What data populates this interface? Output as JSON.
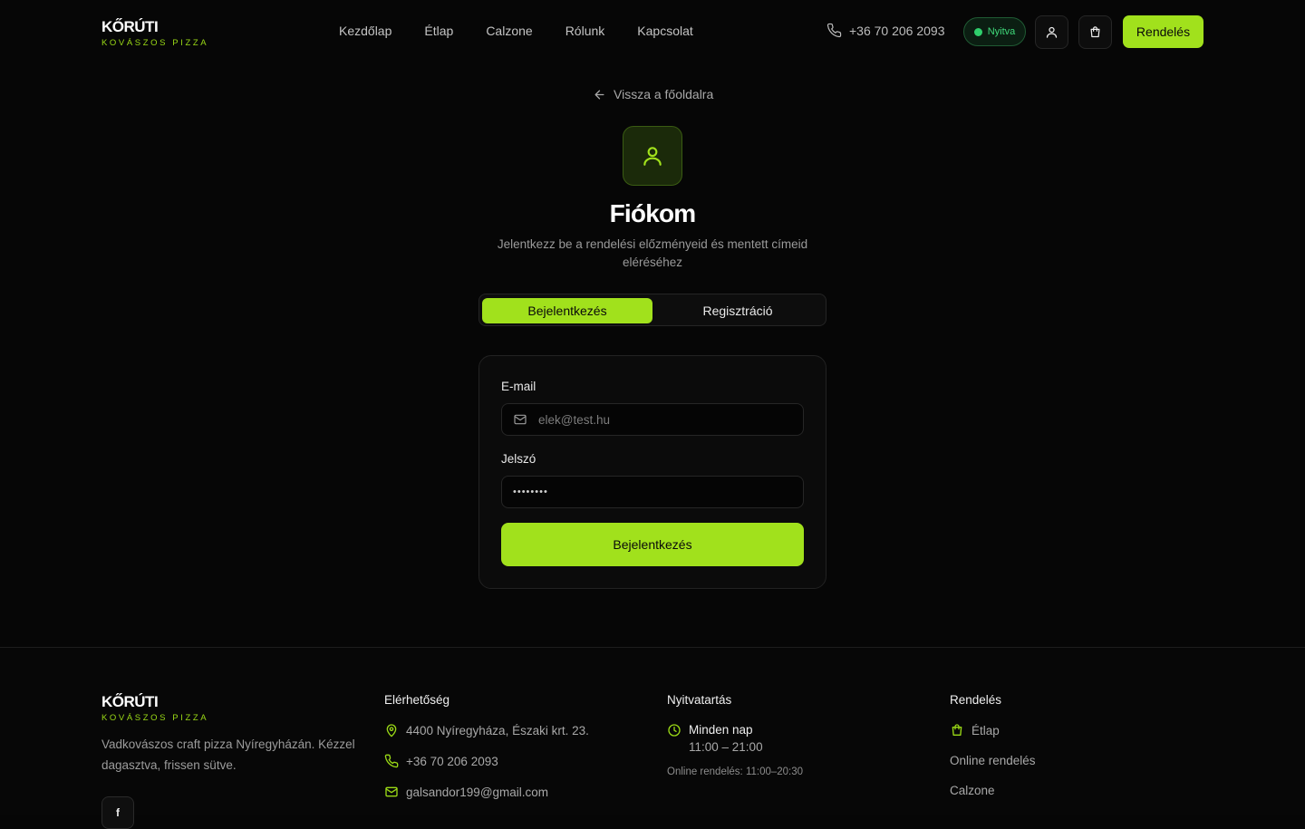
{
  "header": {
    "logo_title": "KŐRÚTI",
    "logo_sub": "KOVÁSZOS PIZZA",
    "nav": [
      "Kezdőlap",
      "Étlap",
      "Calzone",
      "Rólunk",
      "Kapcsolat"
    ],
    "phone": "+36 70 206 2093",
    "status": "Nyitva",
    "order_label": "Rendelés"
  },
  "main": {
    "back_label": "Vissza a főoldalra",
    "title": "Fiókom",
    "subtitle": "Jelentkezz be a rendelési előzményeid és mentett címeid eléréséhez",
    "tabs": [
      "Bejelentkezés",
      "Regisztráció"
    ],
    "email_label": "E-mail",
    "email_placeholder": "elek@test.hu",
    "password_label": "Jelszó",
    "password_placeholder": "••••••••",
    "submit_label": "Bejelentkezés"
  },
  "footer": {
    "logo_title": "KŐRÚTI",
    "logo_sub": "KOVÁSZOS PIZZA",
    "description": "Vadkovászos craft pizza Nyíregyházán. Kézzel dagasztva, frissen sütve.",
    "contact_heading": "Elérhetőség",
    "address": "4400 Nyíregyháza, Északi krt. 23.",
    "phone": "+36 70 206 2093",
    "email": "galsandor199@gmail.com",
    "hours_heading": "Nyitvatartás",
    "hours_days": "Minden nap",
    "hours_time": "11:00 – 21:00",
    "online_hours": "Online rendelés: 11:00–20:30",
    "order_heading": "Rendelés",
    "order_links": [
      "Étlap",
      "Online rendelés",
      "Calzone"
    ]
  },
  "colors": {
    "accent": "#a1e11c",
    "background": "#060606",
    "open": "#2fcf6c"
  },
  "icons": [
    "phone-icon",
    "user-icon",
    "cart-icon",
    "arrow-left-icon",
    "mail-icon",
    "map-pin-icon",
    "clock-icon",
    "bag-icon",
    "facebook-icon"
  ]
}
